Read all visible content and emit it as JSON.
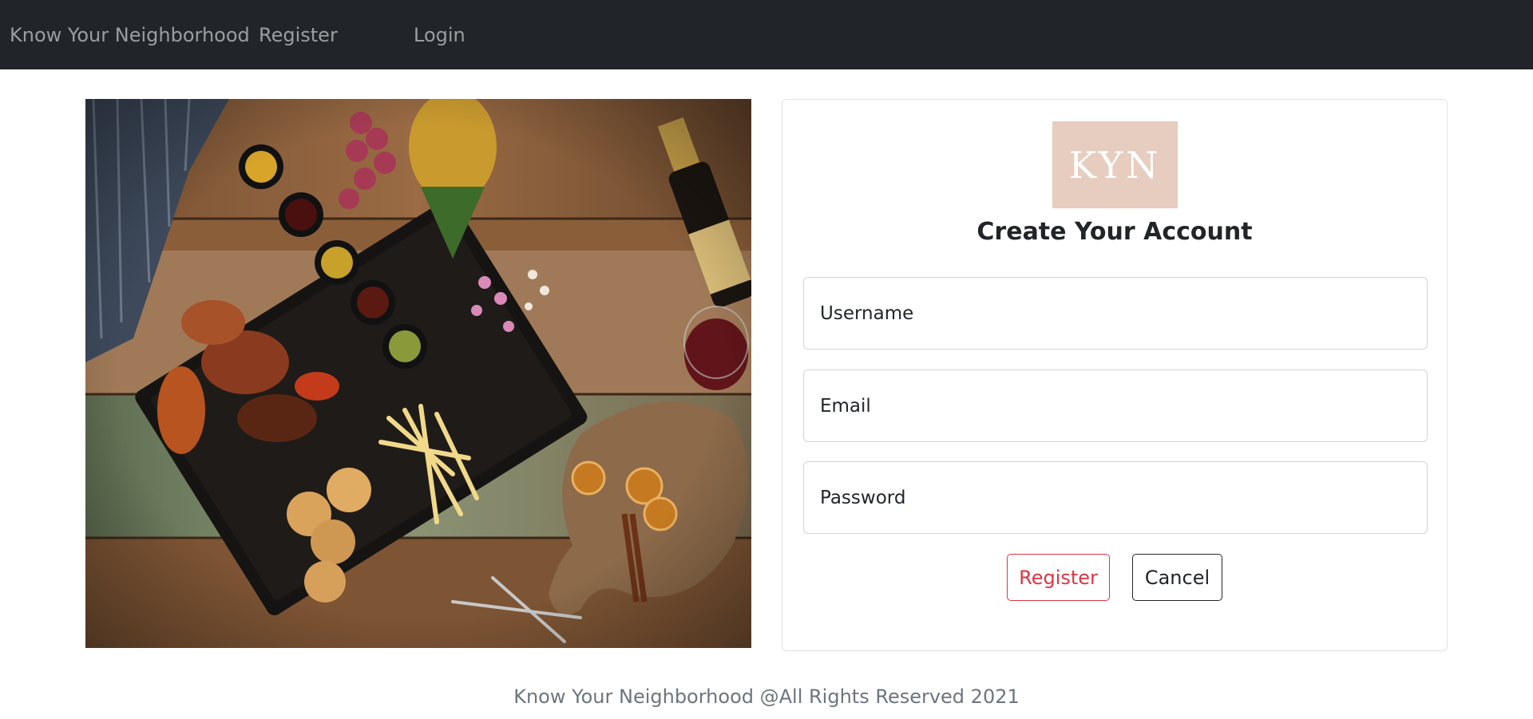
{
  "navbar": {
    "brand": "Know Your Neighborhood",
    "links": [
      {
        "label": "Register"
      },
      {
        "label": "Login"
      }
    ]
  },
  "form": {
    "logo_text": "KYN",
    "title": "Create Your Account",
    "username_placeholder": "Username",
    "email_placeholder": "Email",
    "password_placeholder": "Password",
    "register_label": "Register",
    "cancel_label": "Cancel"
  },
  "footer": {
    "text": "Know Your Neighborhood @All Rights Reserved 2021"
  },
  "colors": {
    "navbar_bg": "#212529",
    "logo_bg": "#e6cdbf",
    "register_accent": "#dc3545",
    "footer_text": "#6c757d"
  }
}
